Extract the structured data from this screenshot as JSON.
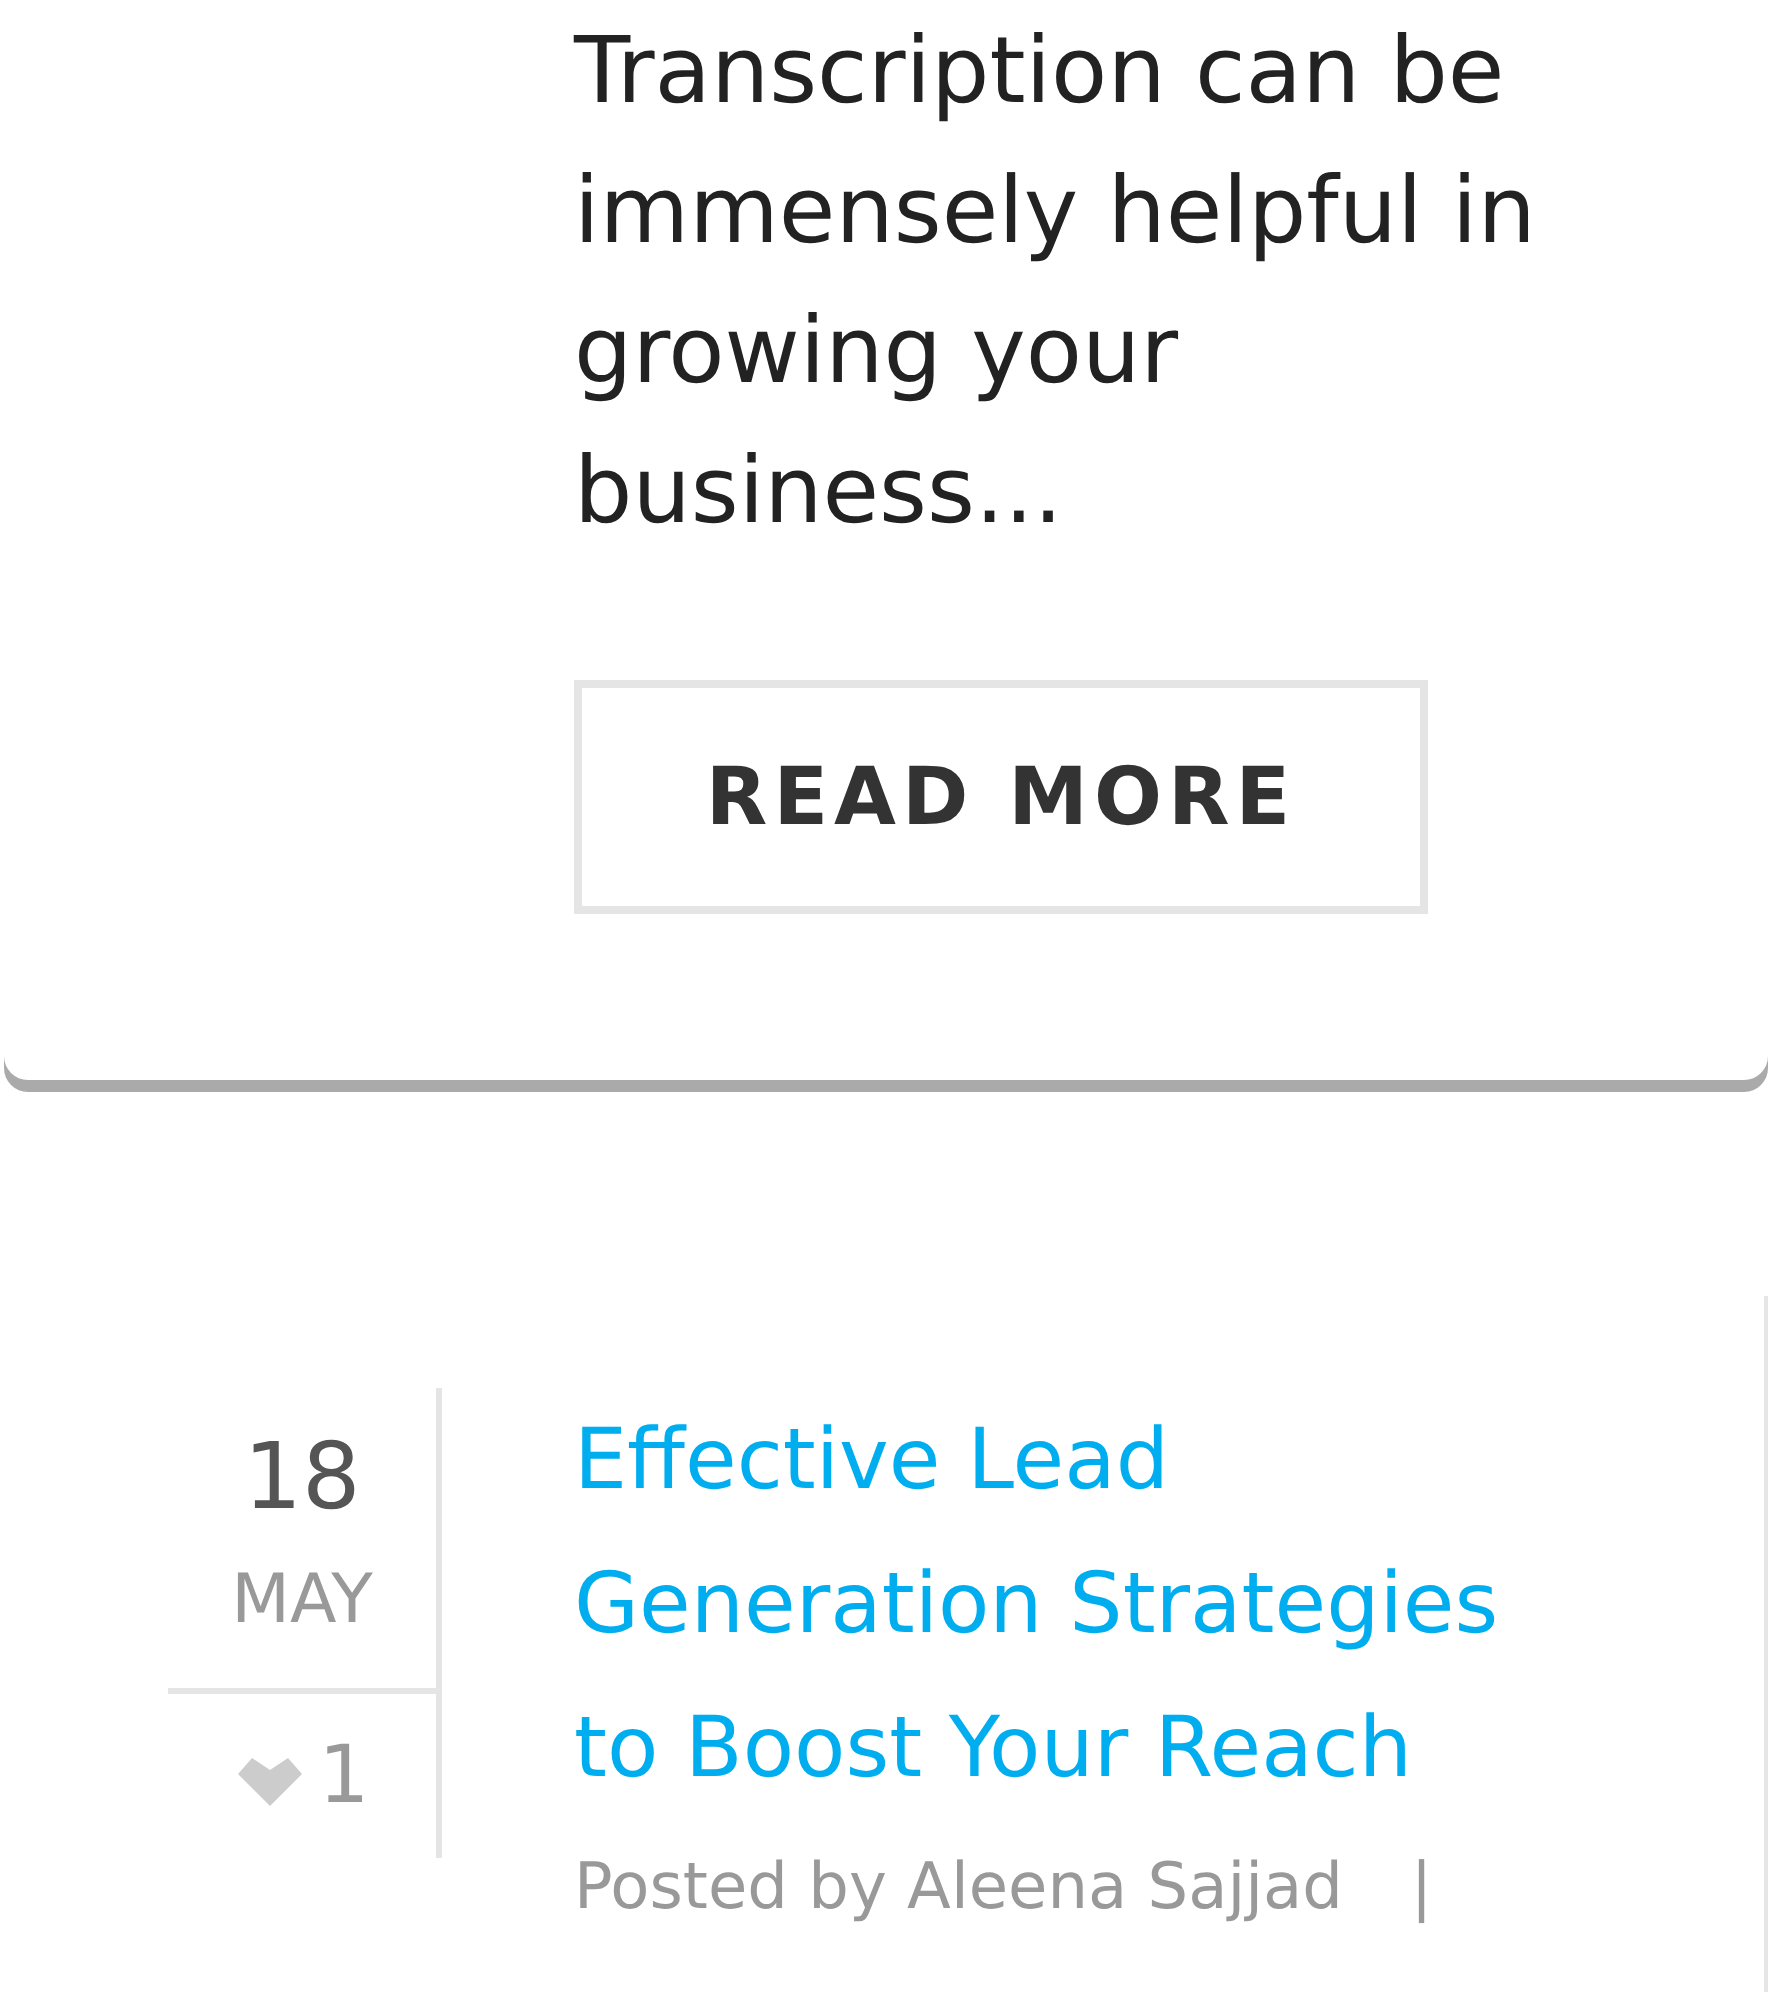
{
  "previous_post": {
    "excerpt": "Transcription can be immensely helpful in growing your business...",
    "button": "READ MORE"
  },
  "post": {
    "day": "18",
    "month": "MAY",
    "likes": "1",
    "title": "Effective Lead Generation Strategies to Boost Your Reach",
    "byline": "Posted by Aleena Sajjad",
    "separator": "|"
  }
}
